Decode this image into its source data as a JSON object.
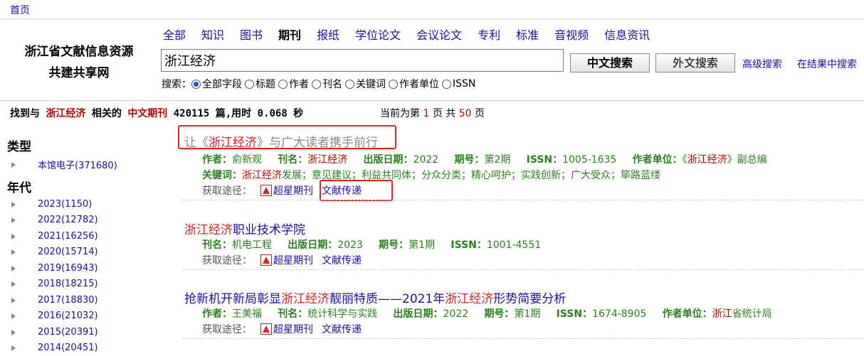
{
  "topbar": {
    "home": "首页"
  },
  "logo": {
    "line1": "浙江省文献信息资源",
    "line2": "共建共享网"
  },
  "nav": {
    "items": [
      "全部",
      "知识",
      "图书",
      "期刊",
      "报纸",
      "学位论文",
      "会议论文",
      "专利",
      "标准",
      "音视频",
      "信息资讯"
    ],
    "active_index": 3
  },
  "search": {
    "value": "浙江经济",
    "cn_button": "中文搜索",
    "foreign_button": "外文搜索",
    "advanced": "高级搜索",
    "within": "在结果中搜索",
    "field_label": "搜索：",
    "fields": [
      "全部字段",
      "标题",
      "作者",
      "刊名",
      "关键词",
      "作者单位",
      "ISSN"
    ],
    "selected_field_index": 0
  },
  "summary": {
    "prefix": "找到与",
    "query": "浙江经济",
    "mid": "相关的",
    "category": "中文期刊",
    "count_text": "420115 篇,用时 0.068 秒",
    "page_prefix": "当前为第",
    "page_current": "1",
    "page_mid": "页 共",
    "page_total": "50",
    "page_suffix": "页"
  },
  "sidebar": {
    "type_heading": "类型",
    "type_items": [
      "本馆电子(371680)"
    ],
    "year_heading": "年代",
    "year_items": [
      "2023(1150)",
      "2022(12782)",
      "2021(16256)",
      "2020(15714)",
      "2019(16943)",
      "2018(18215)",
      "2017(18830)",
      "2016(21032)",
      "2015(20391)",
      "2014(20451)"
    ]
  },
  "results": [
    {
      "title_pre": "让《",
      "title_hl": "浙江经济",
      "title_post": "》与广大读者携手前行",
      "author_label": "作者：",
      "author": "俞新观",
      "journal_label": "刊名：",
      "journal": "浙江经济",
      "date_label": "出版日期：",
      "date": "2022",
      "issue_label": "期号：",
      "issue": "第2期",
      "issn_label": "ISSN：",
      "issn": "1005-1635",
      "unit_label": "作者单位：",
      "unit_pre": "《",
      "unit_hl": "浙江经济",
      "unit_post": "》副总编",
      "keywords_label": "关键词：",
      "kw_hl": "浙江经济",
      "kw_rest": "发展；意见建议；利益共同体；分众分类；精心呵护；实践创新；广大受众；筚路蓝缕",
      "acq_label": "获取途径：",
      "acq_link1": "超星期刊",
      "acq_link2": "文献传递"
    },
    {
      "title_hl": "浙江经济",
      "title_post": "职业技术学院",
      "journal_label": "刊名：",
      "journal": "机电工程",
      "date_label": "出版日期：",
      "date": "2023",
      "issue_label": "期号：",
      "issue": "第1期",
      "issn_label": "ISSN：",
      "issn": "1001-4551",
      "acq_label": "获取途径：",
      "acq_link1": "超星期刊",
      "acq_link2": "文献传递"
    },
    {
      "title_a": "抢新机开新局彰显",
      "title_hl1": "浙江经济",
      "title_b": "靓丽特质——2021年",
      "title_hl2": "浙江经济",
      "title_c": "形势简要分析",
      "author_label": "作者：",
      "author": "王美福",
      "journal_label": "刊名：",
      "journal": "统计科学与实践",
      "date_label": "出版日期：",
      "date": "2022",
      "issue_label": "期号：",
      "issue": "第1期",
      "issn_label": "ISSN：",
      "issn": "1674-8905",
      "unit_label": "作者单位：",
      "unit_hl": "浙江",
      "unit_post": "省统计局",
      "acq_label": "获取途径：",
      "acq_link1": "超星期刊",
      "acq_link2": "文献传递"
    }
  ],
  "colors": {
    "highlight": "#d4211f",
    "meta_green": "#2c7f1f",
    "link_blue": "#1a0dab",
    "annotation_red": "#e8251c"
  }
}
